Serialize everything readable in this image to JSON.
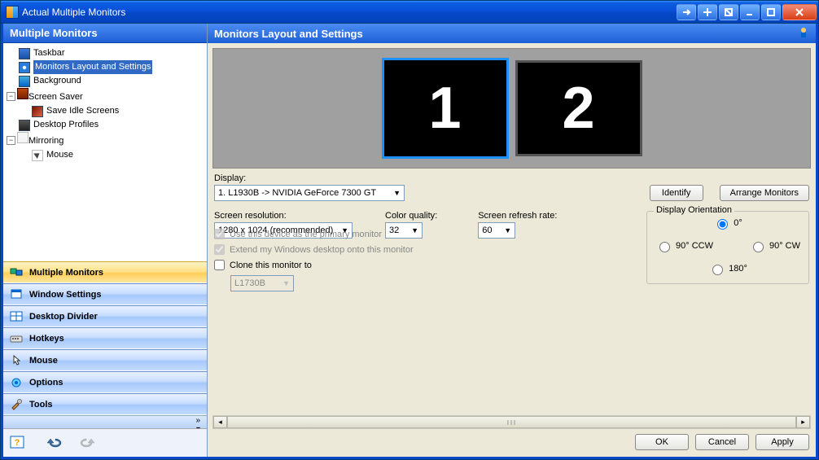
{
  "window": {
    "title": "Actual Multiple Monitors"
  },
  "left": {
    "header": "Multiple Monitors",
    "tree": {
      "taskbar": "Taskbar",
      "mls": "Monitors Layout and Settings",
      "background": "Background",
      "screensaver": "Screen Saver",
      "save_idle": "Save Idle Screens",
      "desktop_profiles": "Desktop Profiles",
      "mirroring": "Mirroring",
      "mouse": "Mouse"
    },
    "nav": {
      "multiple_monitors": "Multiple Monitors",
      "window_settings": "Window Settings",
      "desktop_divider": "Desktop Divider",
      "hotkeys": "Hotkeys",
      "mouse": "Mouse",
      "options": "Options",
      "tools": "Tools"
    }
  },
  "right": {
    "header": "Monitors Layout and Settings",
    "monitors": {
      "m1": "1",
      "m2": "2"
    },
    "labels": {
      "display": "Display:",
      "identify": "Identify",
      "arrange": "Arrange Monitors",
      "screen_res": "Screen resolution:",
      "color_quality": "Color quality:",
      "refresh": "Screen refresh rate:",
      "orientation": "Display Orientation",
      "primary_cb": "Use this device as the primary monitor",
      "extend_cb": "Extend my Windows desktop onto this monitor",
      "clone_cb": "Clone this monitor to"
    },
    "values": {
      "display": "1. L1930B -> NVIDIA GeForce 7300 GT",
      "resolution": "1280 x 1024 (recommended)",
      "color": "32",
      "refresh": "60",
      "clone_target": "L1730B"
    },
    "orientation": {
      "o0": "0°",
      "o90ccw": "90° CCW",
      "o90cw": "90° CW",
      "o180": "180°"
    },
    "footer": {
      "ok": "OK",
      "cancel": "Cancel",
      "apply": "Apply"
    }
  }
}
